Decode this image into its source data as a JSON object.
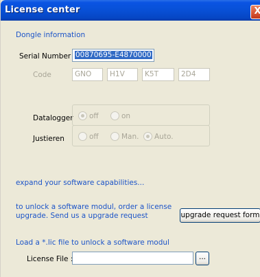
{
  "window": {
    "title": "License center",
    "close_glyph": "X"
  },
  "dongle": {
    "section_label": "Dongle information",
    "serial_label": "Serial Number :",
    "serial_value": "00870695-E4870000",
    "code_label": "Code",
    "codes": [
      "GNO",
      "H1V",
      "K5T",
      "2D4"
    ]
  },
  "datalogger": {
    "label": "Datalogger",
    "options": [
      {
        "label": "off",
        "checked": true
      },
      {
        "label": "on",
        "checked": false
      }
    ]
  },
  "justieren": {
    "label": "Justieren",
    "options": [
      {
        "label": "off",
        "checked": false
      },
      {
        "label": "Man.",
        "checked": false
      },
      {
        "label": "Auto.",
        "checked": true
      }
    ]
  },
  "expand": {
    "label": "expand your software capabilities..."
  },
  "upgrade": {
    "text_line1": "to unlock a software modul, order a license",
    "text_line2": "upgrade. Send us a upgrade request",
    "button_label": "upgrade request form"
  },
  "license": {
    "load_label": "Load a *.lic file to unlock a software modul",
    "file_label": "License File :",
    "file_value": "",
    "browse_label": "..."
  },
  "colors": {
    "titlebar": "#0850d6",
    "link_text": "#1c54c8",
    "dialog_bg": "#ece9d8"
  }
}
